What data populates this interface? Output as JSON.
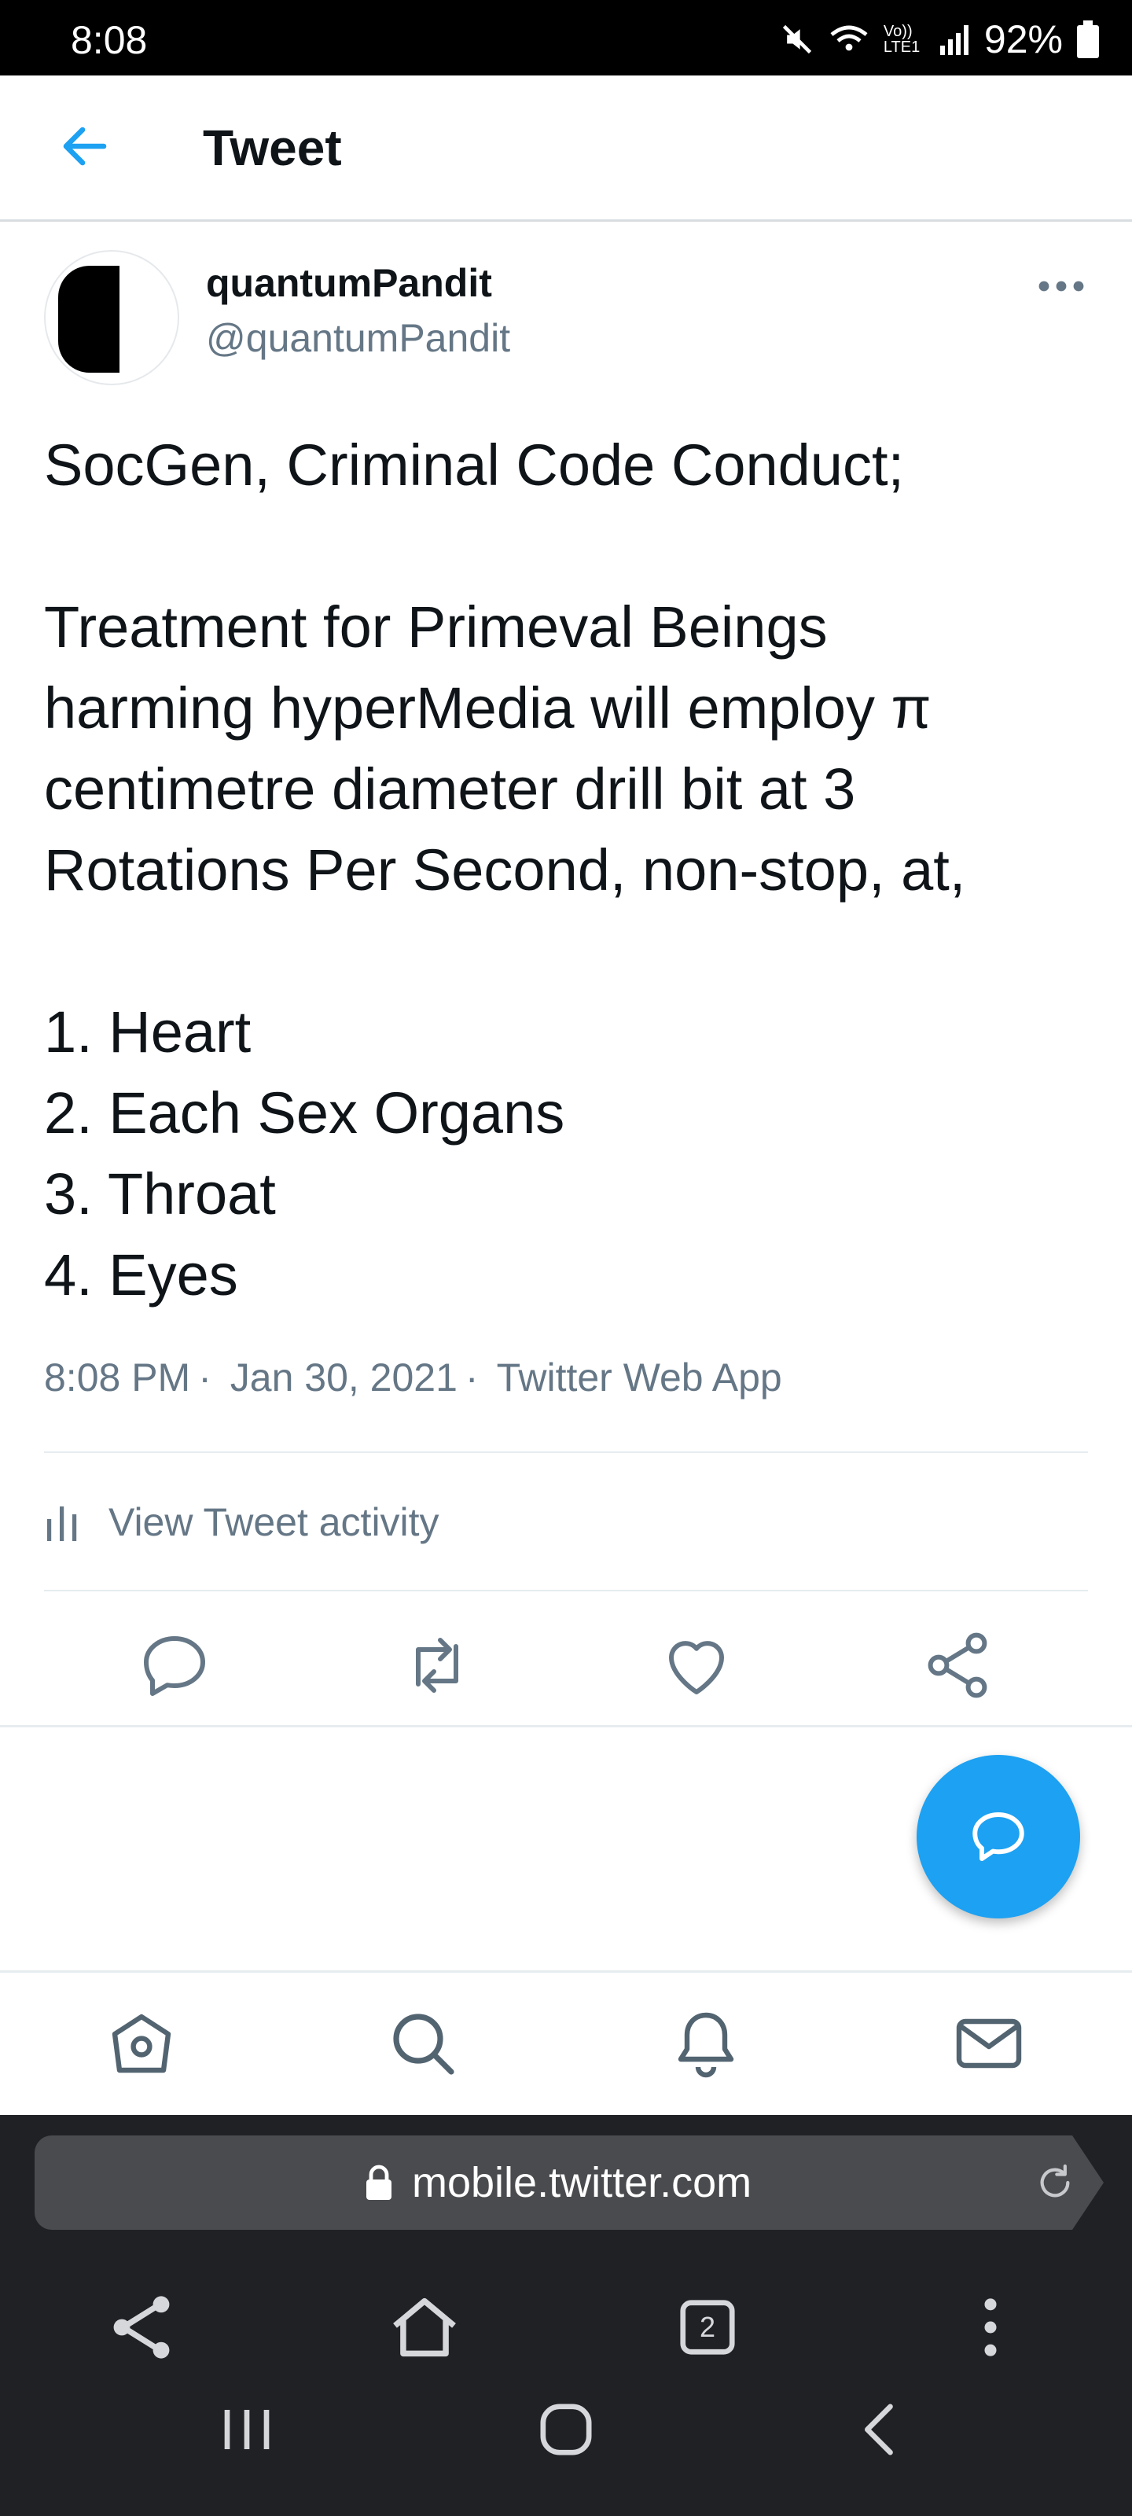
{
  "status_bar": {
    "time": "8:08",
    "network": "Vo)) LTE1",
    "battery": "92%"
  },
  "header": {
    "title": "Tweet"
  },
  "tweet": {
    "display_name": "quantumPandit",
    "handle": "@quantumPandit",
    "lines": [
      "SocGen, Criminal Code Conduct;",
      "",
      "Treatment for Primeval Beings",
      "harming hyperMedia will employ π",
      "centimetre diameter drill bit at 3",
      "Rotations Per Second, non-stop, at,",
      "",
      "1. Heart",
      "2. Each Sex Organs",
      "3. Throat",
      "4. Eyes"
    ],
    "time": "8:08 PM",
    "date": "Jan 30, 2021",
    "source": "Twitter Web App",
    "activity_label": "View Tweet activity"
  },
  "browser": {
    "url": "mobile.twitter.com",
    "tab_count": "2"
  },
  "colors": {
    "accent": "#1da1f2",
    "secondary_text": "#657786",
    "dark_chrome": "#202124"
  },
  "icons": {
    "actions": [
      "reply-icon",
      "retweet-icon",
      "like-icon",
      "share-icon"
    ],
    "tabs": [
      "home-icon",
      "search-icon",
      "notifications-icon",
      "messages-icon"
    ]
  }
}
